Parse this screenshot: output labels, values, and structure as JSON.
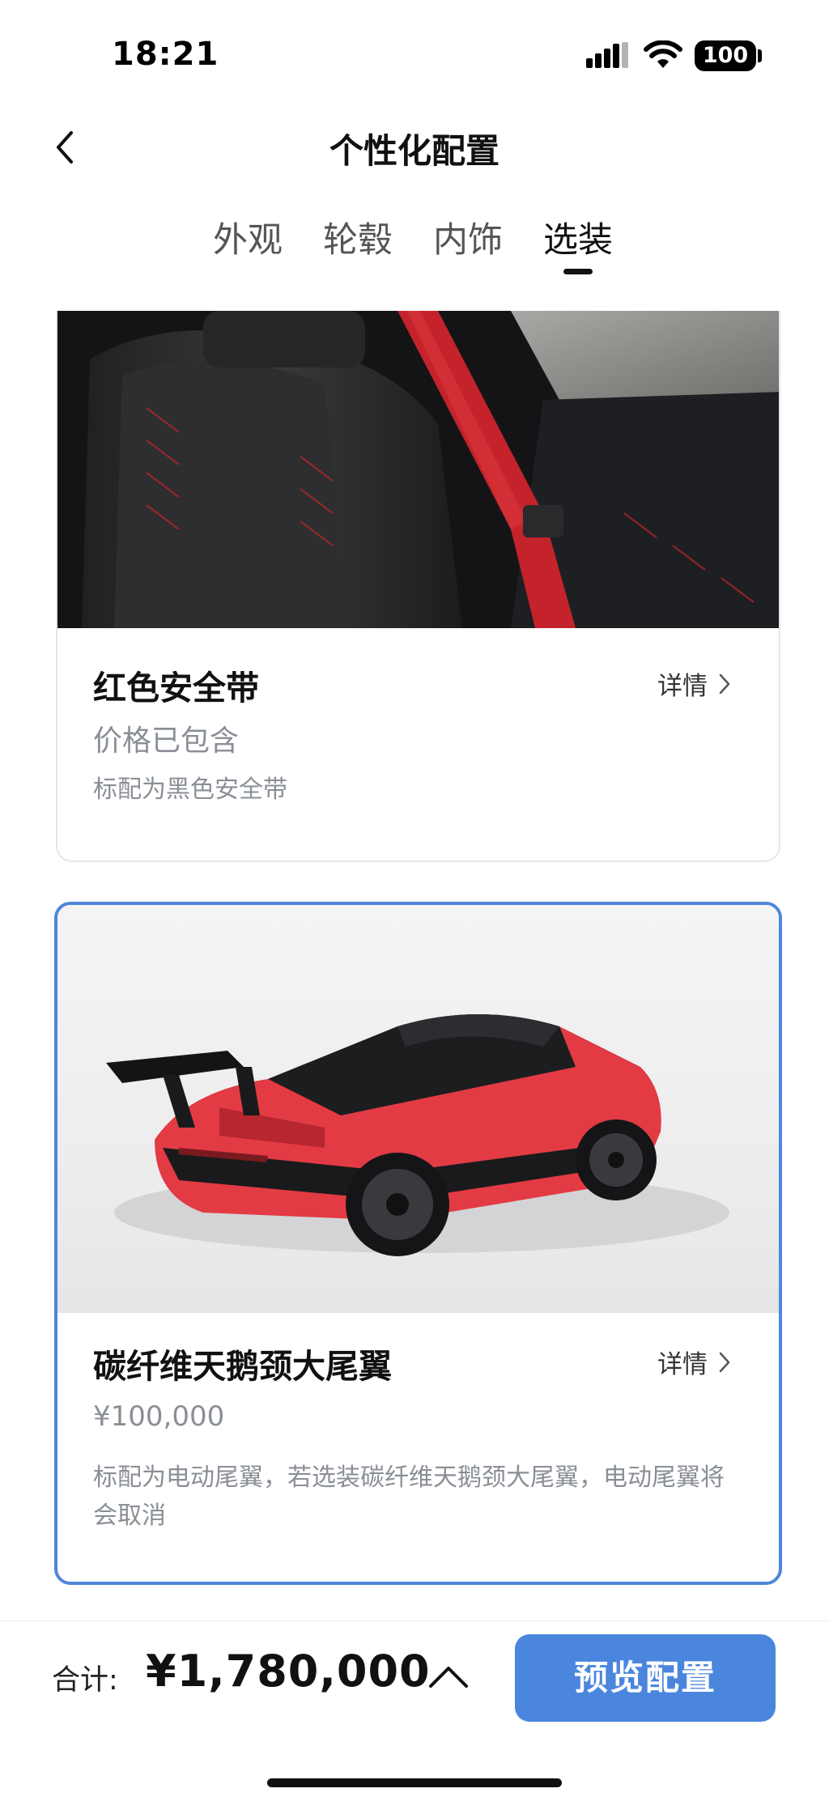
{
  "status_bar": {
    "time": "18:21",
    "battery": "100"
  },
  "header": {
    "title": "个性化配置"
  },
  "tabs": [
    {
      "label": "外观",
      "active": false
    },
    {
      "label": "轮毂",
      "active": false
    },
    {
      "label": "内饰",
      "active": false
    },
    {
      "label": "选装",
      "active": true
    }
  ],
  "options": [
    {
      "name": "红色安全带",
      "price": "价格已包含",
      "note": "标配为黑色安全带",
      "details_label": "详情",
      "selected": false
    },
    {
      "name": "碳纤维天鹅颈大尾翼",
      "price": "¥100,000",
      "note": "标配为电动尾翼，若选装碳纤维天鹅颈大尾翼，电动尾翼将会取消",
      "details_label": "详情",
      "selected": true
    }
  ],
  "footer": {
    "total_label": "合计:",
    "total_amount": "¥1,780,000",
    "preview_button": "预览配置"
  },
  "colors": {
    "accent": "#4a86de",
    "selected_border": "#4f86d9",
    "muted_text": "#8a8f96"
  }
}
